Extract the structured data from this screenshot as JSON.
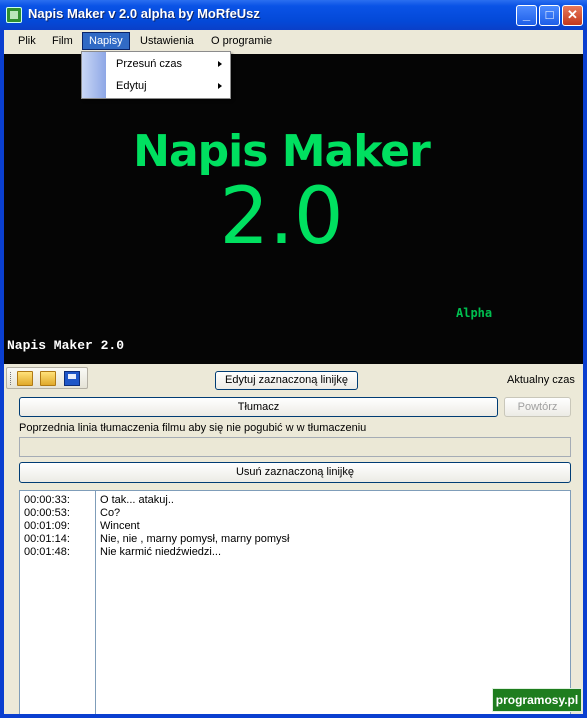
{
  "window": {
    "title": "Napis Maker v 2.0 alpha by MoRfeUsz"
  },
  "menubar": {
    "items": [
      "Plik",
      "Film",
      "Napisy",
      "Ustawienia",
      "O programie"
    ],
    "open_menu": {
      "items": [
        "Przesuń czas",
        "Edytuj"
      ]
    }
  },
  "video": {
    "logo_title": "Napis Maker",
    "logo_version": "2.0",
    "logo_tag": "Alpha",
    "caption": "Napis Maker 2.0"
  },
  "controls": {
    "edit_line_button": "Edytuj zaznaczoną linijkę",
    "current_time_label": "Aktualny czas",
    "translate_button": "Tłumacz",
    "repeat_button": "Powtórz",
    "previous_line_label": "Poprzednia linia tłumaczenia filmu aby się nie pogubić w w tłumaczeniu",
    "previous_line_value": "",
    "delete_line_button": "Usuń zaznaczoną linijkę"
  },
  "subtitles": [
    {
      "time": "00:00:33:",
      "text": "O tak... atakuj.."
    },
    {
      "time": "00:00:53:",
      "text": "Co?"
    },
    {
      "time": "00:01:09:",
      "text": "Wincent"
    },
    {
      "time": "00:01:14:",
      "text": "Nie, nie , marny pomysł, marny pomysł"
    },
    {
      "time": "00:01:48:",
      "text": "Nie karmić niedźwiedzi..."
    }
  ],
  "watermark": "programosy.pl"
}
